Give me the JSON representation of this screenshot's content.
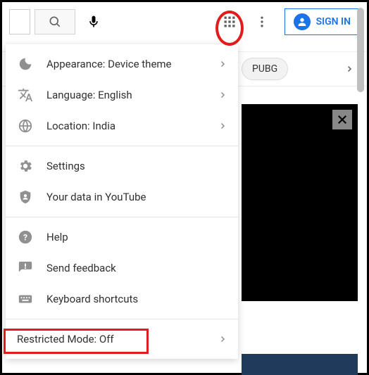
{
  "topbar": {
    "signin_label": "SIGN IN"
  },
  "chips": {
    "pubg": "PUBG"
  },
  "menu": {
    "appearance": "Appearance: Device theme",
    "language": "Language: English",
    "location": "Location: India",
    "settings": "Settings",
    "your_data": "Your data in YouTube",
    "help": "Help",
    "feedback": "Send feedback",
    "shortcuts": "Keyboard shortcuts",
    "restricted": "Restricted Mode: Off"
  }
}
